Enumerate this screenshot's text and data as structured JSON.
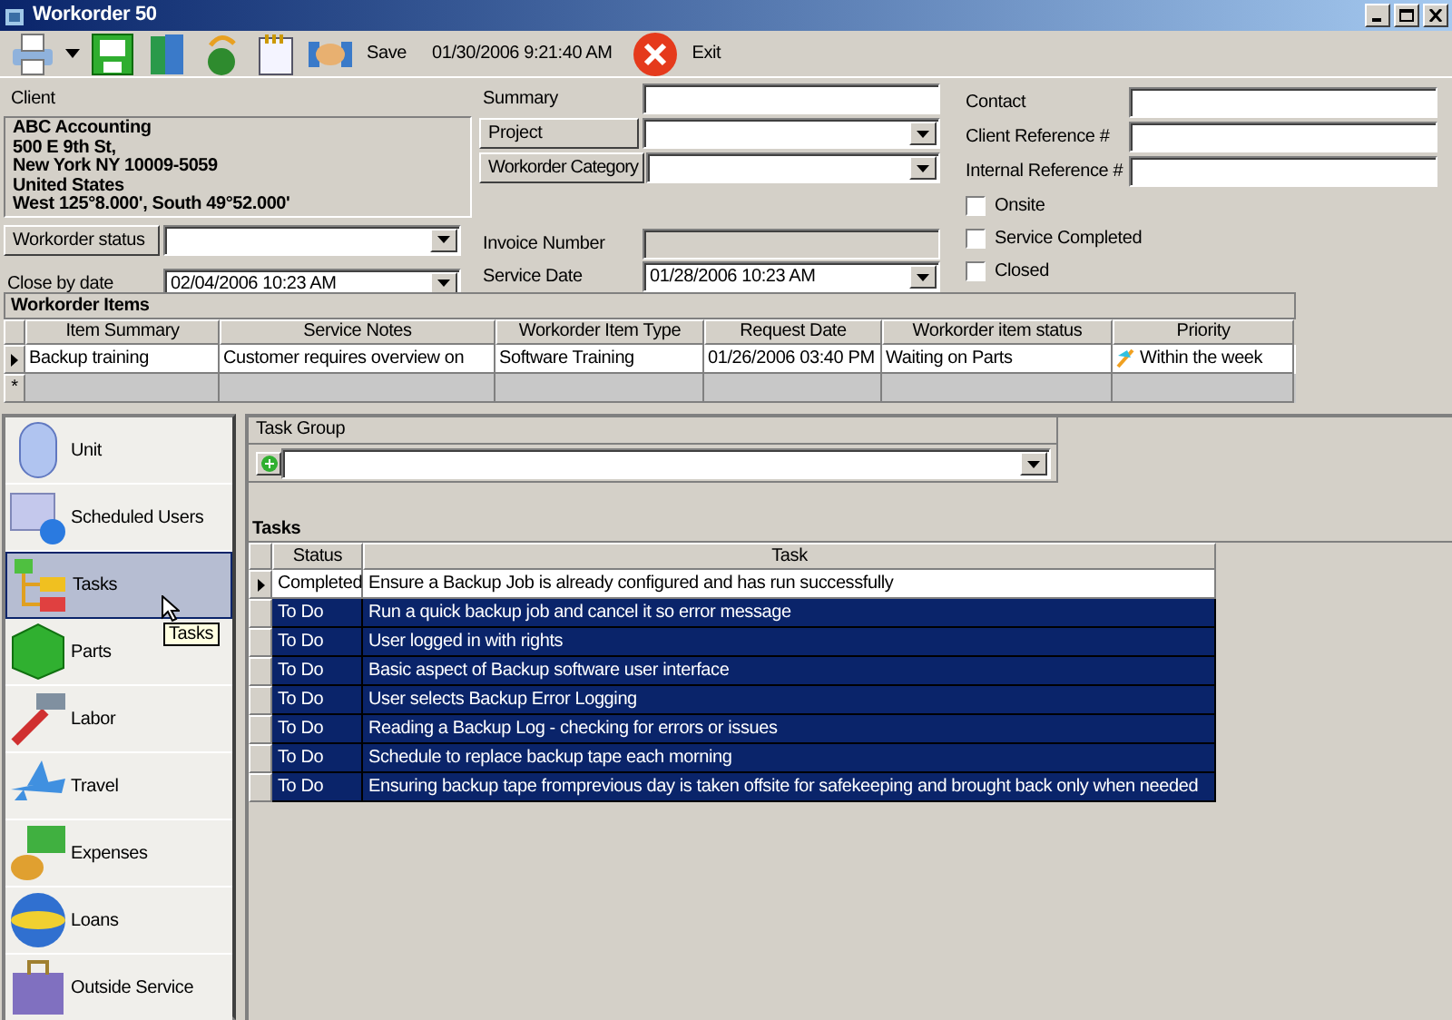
{
  "window": {
    "title": "Workorder 50"
  },
  "toolbar": {
    "save_label": "Save",
    "timestamp": "01/30/2006 9:21:40 AM",
    "exit_label": "Exit"
  },
  "client": {
    "label": "Client",
    "address_lines": [
      "ABC Accounting",
      "500 E 9th St,",
      "New York NY 10009-5059",
      "United States",
      "West 125°8.000', South 49°52.000'"
    ]
  },
  "workorder_status": {
    "label": "Workorder status"
  },
  "close_by_date": {
    "label": "Close by date",
    "value": "02/04/2006 10:23 AM"
  },
  "summary": {
    "label": "Summary"
  },
  "project": {
    "label": "Project"
  },
  "workorder_category": {
    "label": "Workorder Category"
  },
  "invoice_number": {
    "label": "Invoice Number",
    "disabled": true
  },
  "service_date": {
    "label": "Service Date",
    "value": "01/28/2006 10:23 AM"
  },
  "contact": {
    "label": "Contact"
  },
  "client_reference": {
    "label": "Client Reference #"
  },
  "internal_reference": {
    "label": "Internal Reference #"
  },
  "checkboxes": [
    {
      "label": "Onsite",
      "checked": false
    },
    {
      "label": "Service Completed",
      "checked": false
    },
    {
      "label": "Closed",
      "checked": false
    }
  ],
  "workorder_items": {
    "title": "Workorder Items",
    "columns": [
      "Item Summary",
      "Service Notes",
      "Workorder Item Type",
      "Request Date",
      "Workorder item status",
      "Priority"
    ],
    "rows": [
      {
        "current": true,
        "cells": [
          "Backup training",
          "Customer requires overview on",
          "Software Training",
          "01/26/2006 03:40 PM",
          "Waiting on Parts",
          "Within the week"
        ]
      }
    ],
    "new_row_marker": "*"
  },
  "nav": [
    {
      "label": "Unit",
      "selected": false
    },
    {
      "label": "Scheduled Users",
      "selected": false
    },
    {
      "label": "Tasks",
      "selected": true
    },
    {
      "label": "Parts",
      "selected": false
    },
    {
      "label": "Labor",
      "selected": false
    },
    {
      "label": "Travel",
      "selected": false
    },
    {
      "label": "Expenses",
      "selected": false
    },
    {
      "label": "Loans",
      "selected": false
    },
    {
      "label": "Outside Service",
      "selected": false
    }
  ],
  "tooltip": "Tasks",
  "task_group": {
    "label": "Task Group"
  },
  "tasks": {
    "title": "Tasks",
    "columns": [
      "Status",
      "Task"
    ],
    "rows": [
      {
        "current": true,
        "selected": false,
        "status": "Completed",
        "task": "Ensure a Backup Job is already configured and has run successfully"
      },
      {
        "current": false,
        "selected": true,
        "status": "To Do",
        "task": "Run a quick backup job and cancel it so error message"
      },
      {
        "current": false,
        "selected": true,
        "status": "To Do",
        "task": "User logged in with rights"
      },
      {
        "current": false,
        "selected": true,
        "status": "To Do",
        "task": "Basic aspect of Backup software user interface"
      },
      {
        "current": false,
        "selected": true,
        "status": "To Do",
        "task": "User selects Backup Error Logging"
      },
      {
        "current": false,
        "selected": true,
        "status": "To Do",
        "task": "Reading a Backup Log - checking for errors or issues"
      },
      {
        "current": false,
        "selected": true,
        "status": "To Do",
        "task": "Schedule to replace backup tape each morning"
      },
      {
        "current": false,
        "selected": true,
        "status": "To Do",
        "task": "Ensuring backup tape fromprevious day is taken offsite for safekeeping and brought back  only when needed"
      }
    ]
  }
}
